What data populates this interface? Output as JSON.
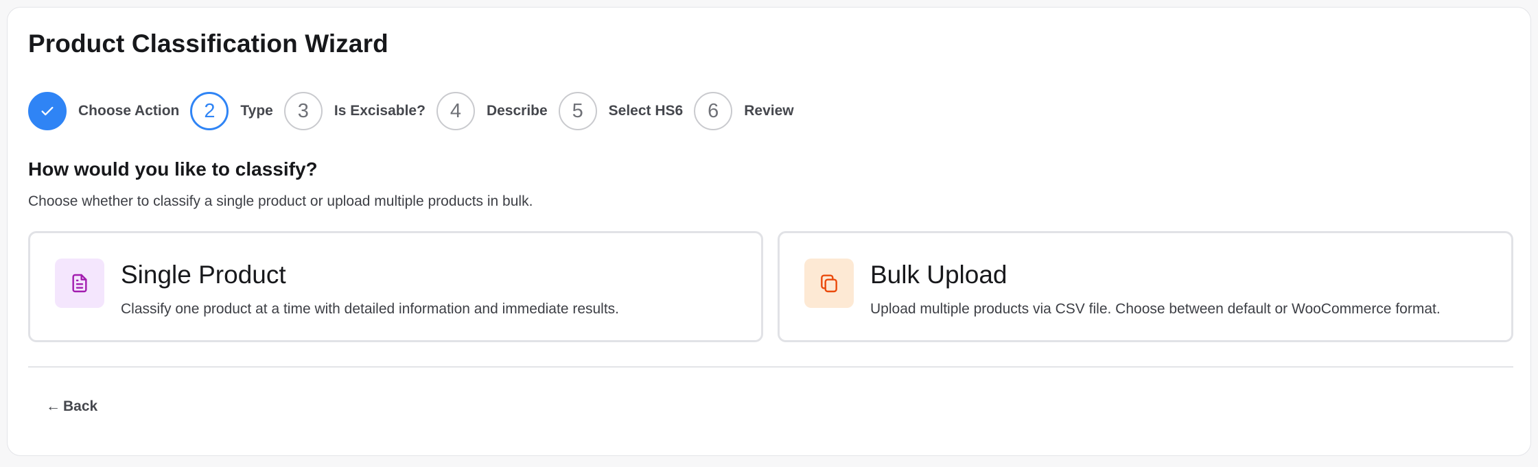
{
  "wizard": {
    "title": "Product Classification Wizard",
    "steps": [
      {
        "number": "",
        "label": "Choose Action",
        "state": "done"
      },
      {
        "number": "2",
        "label": "Type",
        "state": "current"
      },
      {
        "number": "3",
        "label": "Is Excisable?",
        "state": "upcoming"
      },
      {
        "number": "4",
        "label": "Describe",
        "state": "upcoming"
      },
      {
        "number": "5",
        "label": "Select HS6",
        "state": "upcoming"
      },
      {
        "number": "6",
        "label": "Review",
        "state": "upcoming"
      }
    ],
    "heading": "How would you like to classify?",
    "subtitle": "Choose whether to classify a single product or upload multiple products in bulk.",
    "options": [
      {
        "title": "Single Product",
        "description": "Classify one product at a time with detailed information and immediate results.",
        "icon": "document-icon",
        "icon_color": "#a21caf",
        "icon_bg": "#f4e6fd"
      },
      {
        "title": "Bulk Upload",
        "description": "Upload multiple products via CSV file. Choose between default or WooCommerce format.",
        "icon": "copy-icon",
        "icon_color": "#ea4a0c",
        "icon_bg": "#fde9d4"
      }
    ],
    "back_arrow": "←",
    "back_label": "Back"
  },
  "colors": {
    "accent": "#2f84f5",
    "border": "#e1e2e6"
  }
}
